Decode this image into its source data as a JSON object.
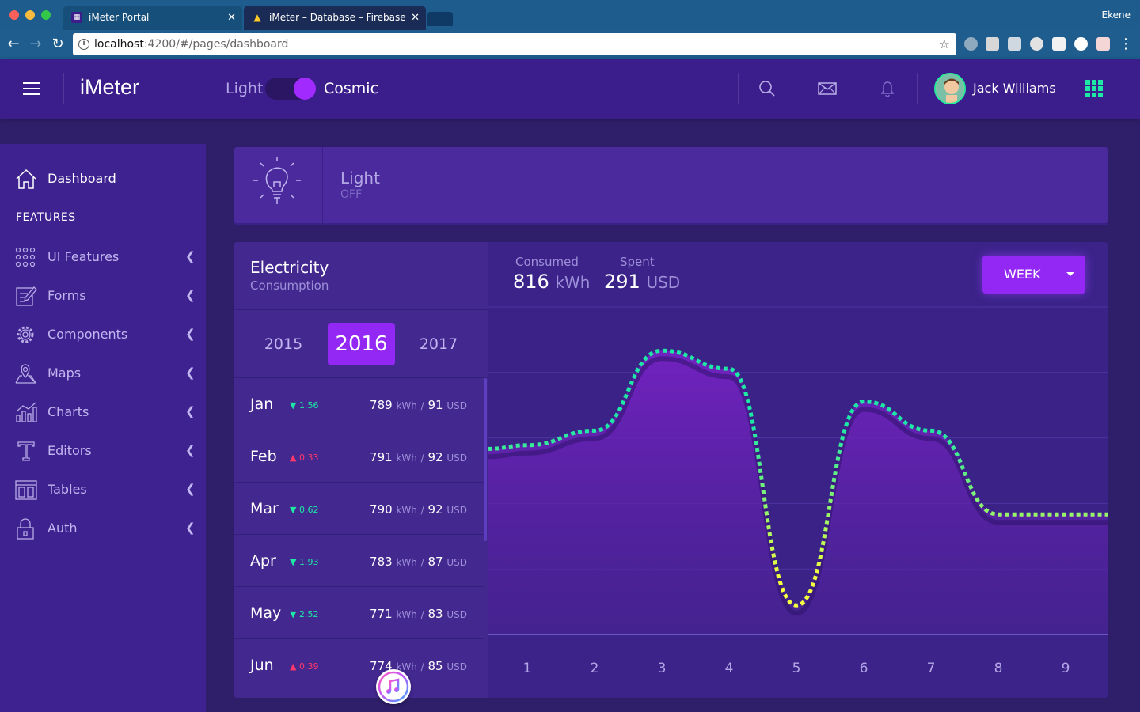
{
  "browser": {
    "tabs": [
      {
        "title": "iMeter Portal"
      },
      {
        "title": "iMeter – Database – Firebase c"
      }
    ],
    "profile_name": "Ekene",
    "url_host": "localhost",
    "url_path": ":4200/#/pages/dashboard"
  },
  "header": {
    "brand": "iMeter",
    "theme_light": "Light",
    "theme_cosmic": "Cosmic",
    "user_name": "Jack Williams",
    "accent": "#1ee8a5"
  },
  "sidebar": {
    "dashboard": "Dashboard",
    "features_title": "FEATURES",
    "items": [
      {
        "label": "UI Features",
        "icon": "dots-grid-icon"
      },
      {
        "label": "Forms",
        "icon": "edit-icon"
      },
      {
        "label": "Components",
        "icon": "gear-icon"
      },
      {
        "label": "Maps",
        "icon": "map-icon"
      },
      {
        "label": "Charts",
        "icon": "chart-icon"
      },
      {
        "label": "Editors",
        "icon": "text-icon"
      },
      {
        "label": "Tables",
        "icon": "table-icon"
      },
      {
        "label": "Auth",
        "icon": "lock-icon"
      }
    ]
  },
  "light_card": {
    "title": "Light",
    "status": "OFF"
  },
  "electricity": {
    "title": "Electricity",
    "subtitle": "Consumption",
    "years": [
      "2015",
      "2016",
      "2017"
    ],
    "selected_year": "2016",
    "months": [
      {
        "name": "Jan",
        "delta": "1.56",
        "direction": "down",
        "kwh": "789",
        "usd": "91"
      },
      {
        "name": "Feb",
        "delta": "0.33",
        "direction": "up",
        "kwh": "791",
        "usd": "92"
      },
      {
        "name": "Mar",
        "delta": "0.62",
        "direction": "down",
        "kwh": "790",
        "usd": "92"
      },
      {
        "name": "Apr",
        "delta": "1.93",
        "direction": "down",
        "kwh": "783",
        "usd": "87"
      },
      {
        "name": "May",
        "delta": "2.52",
        "direction": "down",
        "kwh": "771",
        "usd": "83"
      },
      {
        "name": "Jun",
        "delta": "0.39",
        "direction": "up",
        "kwh": "774",
        "usd": "85"
      }
    ],
    "kwh_unit": "kWh",
    "usd_unit": "USD",
    "separator": "/",
    "consumed_label": "Consumed",
    "consumed_value": "816",
    "consumed_unit": "kWh",
    "spent_label": "Spent",
    "spent_value": "291",
    "spent_unit": "USD",
    "period_button": "WEEK"
  },
  "chart_data": {
    "type": "area",
    "x": [
      1,
      2,
      3,
      4,
      5,
      6,
      7,
      8,
      9
    ],
    "categories": [
      "1",
      "2",
      "3",
      "4",
      "5",
      "6",
      "7",
      "8",
      "9"
    ],
    "values": [
      520,
      560,
      780,
      730,
      80,
      640,
      560,
      330,
      330
    ],
    "ylim": [
      0,
      900
    ],
    "grid": true,
    "line_colors": [
      "#1ee8a5",
      "#f5ff3d"
    ]
  }
}
